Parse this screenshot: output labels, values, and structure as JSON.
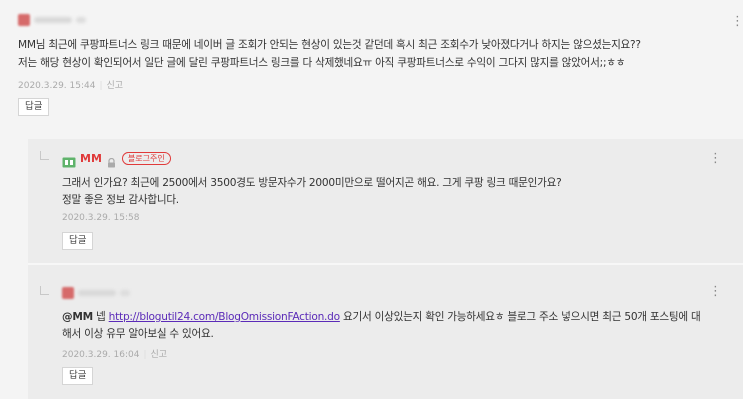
{
  "comment1": {
    "text_line1": "MM님 최근에 쿠팡파트너스 링크 때문에 네이버 글 조회가 안되는 현상이 있는것 같던데 혹시 최근 조회수가 낮아졌다거나 하지는 않으셨는지요??",
    "text_line2": "저는 해당 현상이 확인되어서 일단 글에 달린 쿠팡파트너스 링크를 다 삭제했네요ㅠ 아직 쿠팡파트너스로 수익이 그다지 많지를 않았어서;;ㅎㅎ",
    "date": "2020.3.29. 15:44",
    "report": "신고",
    "reply_label": "답글"
  },
  "reply1": {
    "author": "MM",
    "badge": "블로그주인",
    "text_line1": "그래서 인가요? 최근에 2500에서 3500경도 방문자수가 2000미만으로 떨어지곤 해요. 그게 쿠팡 링크 때문인가요?",
    "text_line2": "정말 좋은 정보 감사합니다.",
    "date": "2020.3.29. 15:58",
    "reply_label": "답글"
  },
  "reply2": {
    "mention": "@MM",
    "pre_link": " 넵 ",
    "link": "http://blogutil24.com/BlogOmissionFAction.do",
    "post_link": " 요기서 이상있는지 확인 가능하세요ㅎ 블로그 주소 넣으시면 최근 50개 포스팅에 대",
    "text_line2": "해서 이상 유무 알아보실 수 있어요.",
    "date": "2020.3.29. 16:04",
    "report": "신고",
    "reply_label": "답글"
  },
  "icons": {
    "more": "kebab-menu-icon",
    "blog": "blog-icon",
    "lock": "lock-icon"
  },
  "colors": {
    "owner_red": "#e03a3a",
    "link_purple": "#5b2bb8",
    "reply_bg": "#ececec",
    "page_bg": "#f4f4f4"
  }
}
